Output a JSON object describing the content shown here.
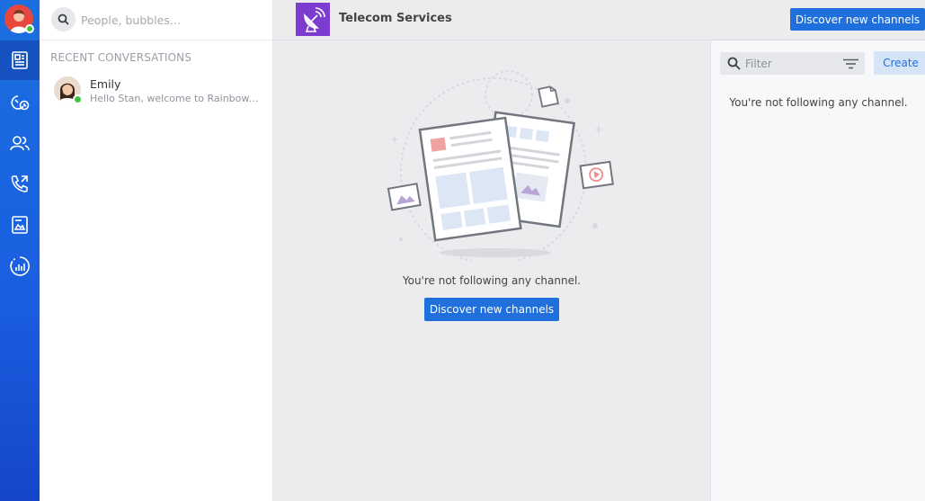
{
  "search": {
    "placeholder": "People, bubbles..."
  },
  "conversations": {
    "section_title": "RECENT CONVERSATIONS",
    "items": [
      {
        "name": "Emily",
        "preview": "Hello Stan, welcome to Rainbow. ..."
      }
    ]
  },
  "channel": {
    "title": "Telecom Services"
  },
  "toolbar": {
    "discover_label": "Discover new channels"
  },
  "main": {
    "empty_message": "You're not following any channel.",
    "discover_label": "Discover new channels"
  },
  "right_panel": {
    "filter_placeholder": "Filter",
    "create_label": "Create",
    "empty_message": "You're not following any channel."
  },
  "nav": [
    "news-icon",
    "recents-icon",
    "contacts-icon",
    "calls-icon",
    "files-icon",
    "dashboard-icon"
  ],
  "colors": {
    "rail": "#1b6fe0",
    "accent": "#1f6fdc",
    "channel_logo": "#7c3ccf",
    "presence": "#3cc43c"
  }
}
